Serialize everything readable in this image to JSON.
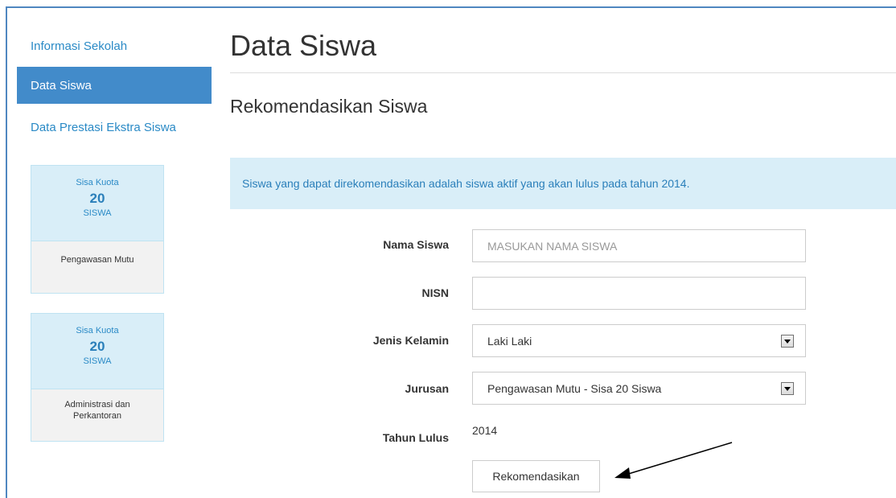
{
  "sidebar": {
    "items": [
      {
        "label": "Informasi Sekolah"
      },
      {
        "label": "Data Siswa"
      },
      {
        "label": "Data Prestasi Ekstra Siswa"
      }
    ],
    "quotas": [
      {
        "label": "Sisa Kuota",
        "count": "20",
        "unit": "SISWA",
        "program": "Pengawasan Mutu"
      },
      {
        "label": "Sisa Kuota",
        "count": "20",
        "unit": "SISWA",
        "program": "Administrasi dan Perkantoran"
      }
    ]
  },
  "main": {
    "title": "Data Siswa",
    "subtitle": "Rekomendasikan Siswa",
    "info": "Siswa yang dapat direkomendasikan adalah siswa aktif yang akan lulus pada tahun 2014.",
    "form": {
      "nama_label": "Nama Siswa",
      "nama_placeholder": "MASUKAN NAMA SISWA",
      "nama_value": "",
      "nisn_label": "NISN",
      "nisn_value": "",
      "jk_label": "Jenis Kelamin",
      "jk_value": "Laki Laki",
      "jurusan_label": "Jurusan",
      "jurusan_value": "Pengawasan Mutu - Sisa 20 Siswa",
      "tahun_label": "Tahun Lulus",
      "tahun_value": "2014",
      "submit_label": "Rekomendasikan"
    }
  },
  "icons": {
    "dropdown": "chevron-down-icon",
    "annotation": "arrow-icon"
  },
  "colors": {
    "accent": "#428bca",
    "link": "#2a8ac6",
    "info_bg": "#d9eef8"
  }
}
